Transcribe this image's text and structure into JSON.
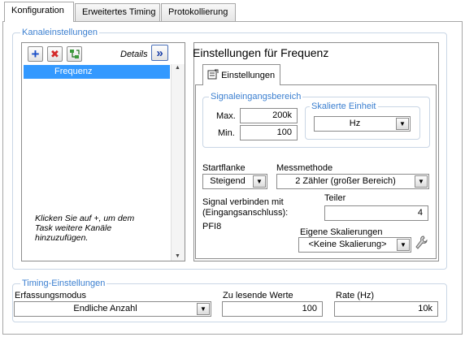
{
  "tabs": [
    {
      "label": "Konfiguration",
      "active": true
    },
    {
      "label": "Erweitertes Timing",
      "active": false
    },
    {
      "label": "Protokollierung",
      "active": false
    }
  ],
  "channel_settings": {
    "group_title": "Kanaleinstellungen",
    "details_label": "Details",
    "details_button": "»",
    "add_button": "+",
    "remove_button": "✖",
    "list_items": [
      "Frequenz"
    ],
    "hint_lines": [
      "Klicken Sie auf +, um dem",
      "Task weitere Kanäle",
      "hinzuzufügen."
    ]
  },
  "frequency_settings": {
    "title": "Einstellungen für Frequenz",
    "tab_label": "Einstellungen",
    "signal_range": {
      "group_title": "Signaleingangsbereich",
      "max_label": "Max.",
      "max_value": "200k",
      "min_label": "Min.",
      "min_value": "100"
    },
    "scaled_unit": {
      "group_title": "Skalierte Einheit",
      "value": "Hz"
    },
    "start_edge": {
      "label": "Startflanke",
      "value": "Steigend"
    },
    "measure_method": {
      "label": "Messmethode",
      "value": "2 Zähler (großer Bereich)"
    },
    "connect_label_line1": "Signal verbinden mit",
    "connect_label_line2": "(Eingangsanschluss):",
    "terminal": "PFI8",
    "divisor": {
      "label": "Teiler",
      "value": "4"
    },
    "custom_scaling": {
      "label": "Eigene Skalierungen",
      "value": "<Keine Skalierung>"
    }
  },
  "timing": {
    "group_title": "Timing-Einstellungen",
    "mode": {
      "label": "Erfassungsmodus",
      "value": "Endliche Anzahl"
    },
    "samples": {
      "label": "Zu lesende Werte",
      "value": "100"
    },
    "rate": {
      "label": "Rate (Hz)",
      "value": "10k"
    }
  },
  "colors": {
    "accent": "#3b7fd0",
    "selection": "#3399ff",
    "group_border": "#c9d6e5"
  }
}
